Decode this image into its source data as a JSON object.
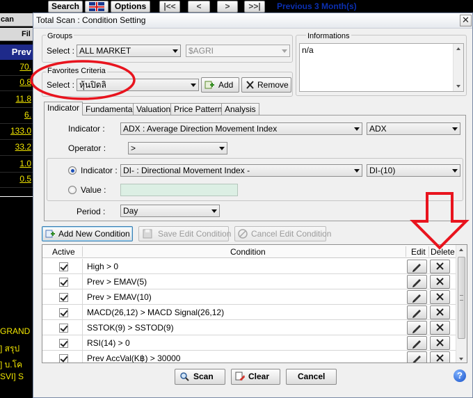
{
  "toolbar": {
    "search_label": "Search",
    "options_label": "Options",
    "first_label": "|<<",
    "prev_label": "<",
    "next_label": ">",
    "last_label": ">>|",
    "period_link": "Previous 3 Month(s)"
  },
  "background": {
    "header_1": "can",
    "header_2": "Fil",
    "prev_label": "Prev",
    "values": [
      "70.",
      "0.8",
      "11.8",
      "6.",
      "133.0",
      "33.2",
      "1.0",
      "0.5"
    ],
    "bottom_lines": [
      "GRAND",
      "] สรุป",
      "] บ.โค",
      "SVI] S"
    ]
  },
  "dialog": {
    "title": "Total Scan : Condition Setting",
    "close_label": "✕",
    "groups": {
      "label": "Groups",
      "select_label": "Select :",
      "group_value": "ALL MARKET",
      "symbol_value": "$AGRI"
    },
    "favorites": {
      "label": "Favorites Criteria",
      "select_label": "Select :",
      "value": "หุ้นปิดลิ",
      "add_label": "Add",
      "remove_label": "Remove"
    },
    "informations": {
      "label": "Informations",
      "text": "n/a"
    },
    "tabs": [
      "Indicator",
      "Fundamental",
      "Valuation",
      "Price Pattern",
      "Analysis"
    ],
    "form": {
      "indicator_label": "Indicator :",
      "indicator_value": "ADX : Average Direction Movement Index",
      "indicator_line": "ADX",
      "operator_label": "Operator :",
      "operator_value": ">",
      "compare_indicator_label": "Indicator :",
      "compare_indicator_value": "DI- : Directional Movement Index -",
      "compare_indicator_line": "DI-(10)",
      "value_label": "Value :",
      "period_label": "Period :",
      "period_value": "Day"
    },
    "actions": {
      "add_new": "Add New Condition",
      "save_edit": "Save Edit Condition",
      "cancel_edit": "Cancel Edit Condition"
    },
    "grid": {
      "headers": {
        "active": "Active",
        "condition": "Condition",
        "edit": "Edit",
        "delete": "Delete"
      },
      "rows": [
        "High > 0",
        "Prev > EMAV(5)",
        "Prev > EMAV(10)",
        "MACD(26,12) > MACD Signal(26,12)",
        "SSTOK(9) > SSTOD(9)",
        "RSI(14) > 0",
        "Prev AccVal(K฿) > 30000"
      ]
    },
    "footer": {
      "scan": "Scan",
      "clear": "Clear",
      "cancel": "Cancel",
      "help": "?"
    }
  },
  "annotation": {
    "ellipse_color": "#e8141e",
    "arrow_color": "#e8141e"
  }
}
